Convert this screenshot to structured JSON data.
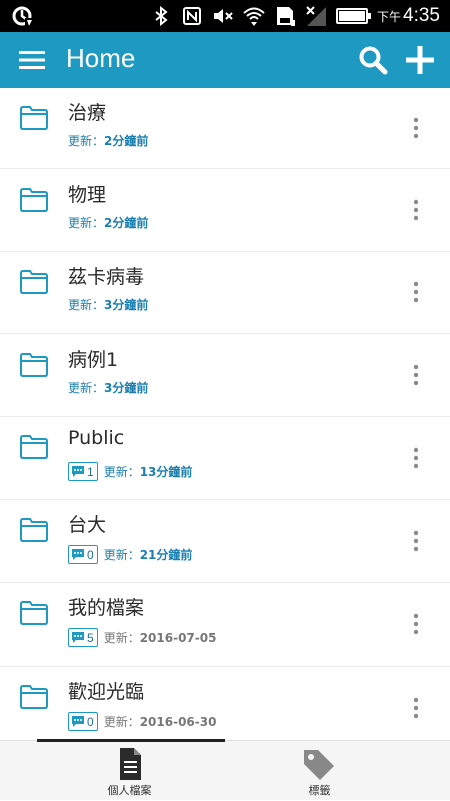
{
  "status_bar": {
    "icons": [
      "sync-icon",
      "bluetooth-icon",
      "nfc-icon",
      "mute-icon",
      "wifi-icon",
      "sd-card-icon",
      "signal-icon",
      "battery-icon"
    ],
    "ampm": "下午",
    "time": "4:35"
  },
  "app_bar": {
    "title": "Home",
    "icons": [
      "menu-icon",
      "search-icon",
      "add-icon"
    ]
  },
  "colors": {
    "accent": "#1e9ac2",
    "link": "#1a7fb0",
    "muted": "#777777"
  },
  "folders": [
    {
      "name": "治療",
      "updated_label": "更新：",
      "updated_value": "2分鐘前",
      "comments": null
    },
    {
      "name": "物理",
      "updated_label": "更新：",
      "updated_value": "2分鐘前",
      "comments": null
    },
    {
      "name": "茲卡病毒",
      "updated_label": "更新：",
      "updated_value": "3分鐘前",
      "comments": null
    },
    {
      "name": "病例1",
      "updated_label": "更新：",
      "updated_value": "3分鐘前",
      "comments": null
    },
    {
      "name": "Public",
      "updated_label": "更新：",
      "updated_value": "13分鐘前",
      "comments": "1"
    },
    {
      "name": "台大",
      "updated_label": "更新：",
      "updated_value": "21分鐘前",
      "comments": "0"
    },
    {
      "name": "我的檔案",
      "updated_label": "更新：",
      "updated_value": "2016-07-05",
      "comments": "5"
    },
    {
      "name": "歡迎光臨",
      "updated_label": "更新：",
      "updated_value": "2016-06-30",
      "comments": "0"
    }
  ],
  "bottom_tabs": [
    {
      "label": "個人檔案",
      "icon": "document-icon",
      "selected": true
    },
    {
      "label": "標籤",
      "icon": "tag-icon",
      "selected": false
    }
  ]
}
